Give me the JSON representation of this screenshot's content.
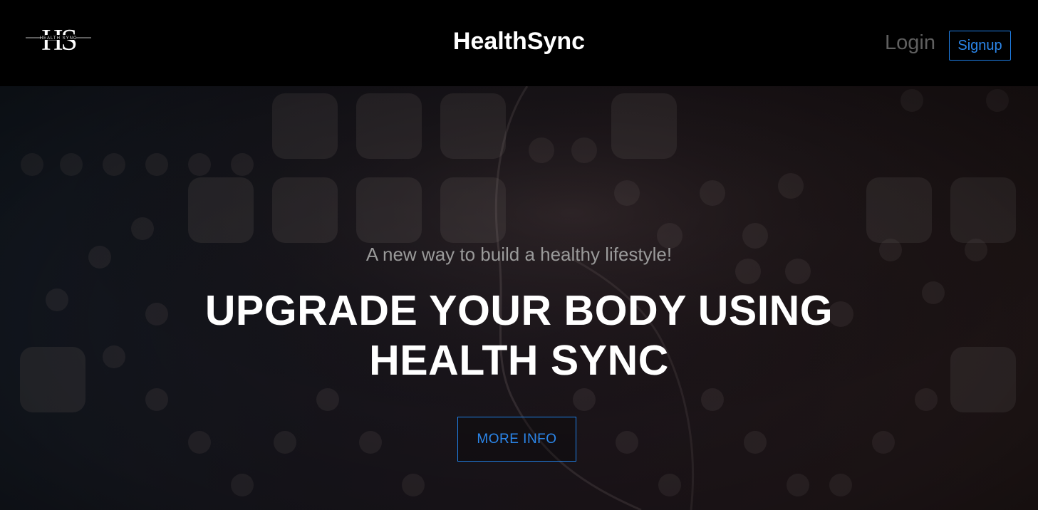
{
  "header": {
    "logo_monogram": "HS",
    "logo_subtext": "HEALTH SYNC",
    "brand": "HealthSync",
    "login_label": "Login",
    "signup_label": "Signup"
  },
  "hero": {
    "tagline": "A new way to build a healthy lifestyle!",
    "headline": "UPGRADE YOUR BODY USING HEALTH SYNC",
    "cta_label": "MORE INFO"
  },
  "colors": {
    "accent": "#1f7fe6",
    "topbar": "#000000",
    "login_text": "#5f5f5f"
  }
}
